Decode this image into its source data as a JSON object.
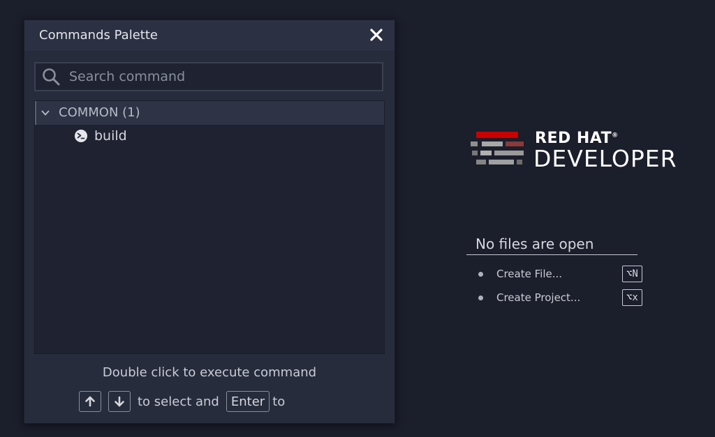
{
  "palette": {
    "title": "Commands Palette",
    "close_icon": "close-icon",
    "search": {
      "placeholder": "Search command",
      "value": "",
      "icon": "search-icon"
    },
    "groups": [
      {
        "label": "COMMON (1)",
        "expanded": true,
        "items": [
          {
            "label": "build",
            "icon": "terminal-command-icon"
          }
        ]
      }
    ],
    "footer": {
      "hint": "Double click to execute command",
      "select_text": "to select and",
      "enter_key": "Enter",
      "to_text": "to",
      "up_icon": "arrow-up-icon",
      "down_icon": "arrow-down-icon"
    }
  },
  "welcome": {
    "logo": {
      "brand": "RED HAT",
      "product": "DEVELOPER",
      "brand_mark": "®"
    },
    "no_files": "No files are open",
    "actions": [
      {
        "label": "Create File...",
        "shortcut": "⌥N"
      },
      {
        "label": "Create Project...",
        "shortcut": "⌥x"
      }
    ]
  },
  "colors": {
    "background": "#1b1e2b",
    "panel": "#272c3c",
    "logo_red": "#cc0000",
    "logo_gray": "#9a9a9a"
  }
}
